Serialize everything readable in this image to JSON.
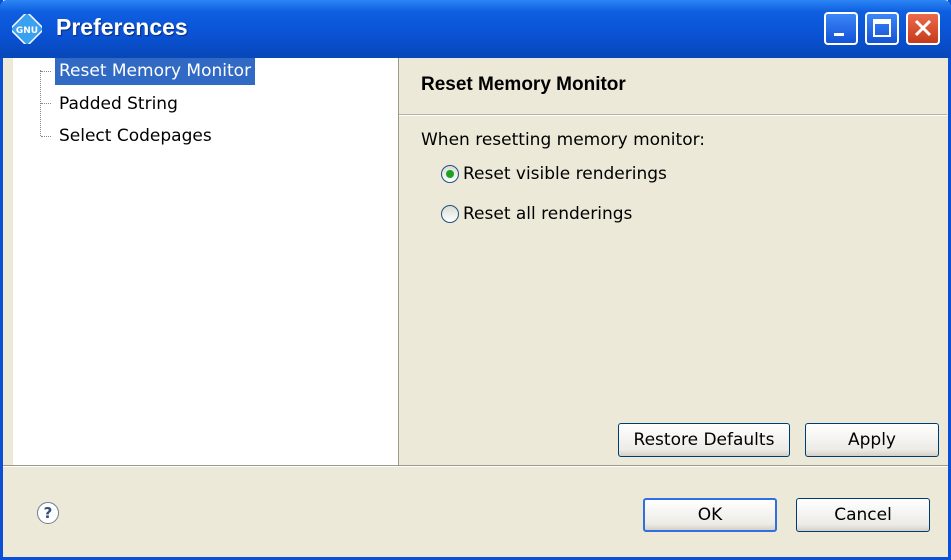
{
  "window": {
    "title": "Preferences",
    "icon_label": "GNU"
  },
  "tree": {
    "items": [
      {
        "label": "Reset Memory Monitor",
        "selected": true
      },
      {
        "label": "Padded String",
        "selected": false
      },
      {
        "label": "Select Codepages",
        "selected": false
      }
    ]
  },
  "page": {
    "title": "Reset Memory Monitor",
    "group_label": "When resetting memory monitor:",
    "options": [
      {
        "label": "Reset visible renderings",
        "checked": true
      },
      {
        "label": "Reset all renderings",
        "checked": false
      }
    ],
    "restore_label": "Restore Defaults",
    "apply_label": "Apply"
  },
  "footer": {
    "help_symbol": "?",
    "ok_label": "OK",
    "cancel_label": "Cancel"
  },
  "colors": {
    "titlebar": "#0a52d4",
    "selection": "#316ac5",
    "dialog_bg": "#ece9d8",
    "radio_dot": "#21a121",
    "close_button": "#c53b1a"
  }
}
